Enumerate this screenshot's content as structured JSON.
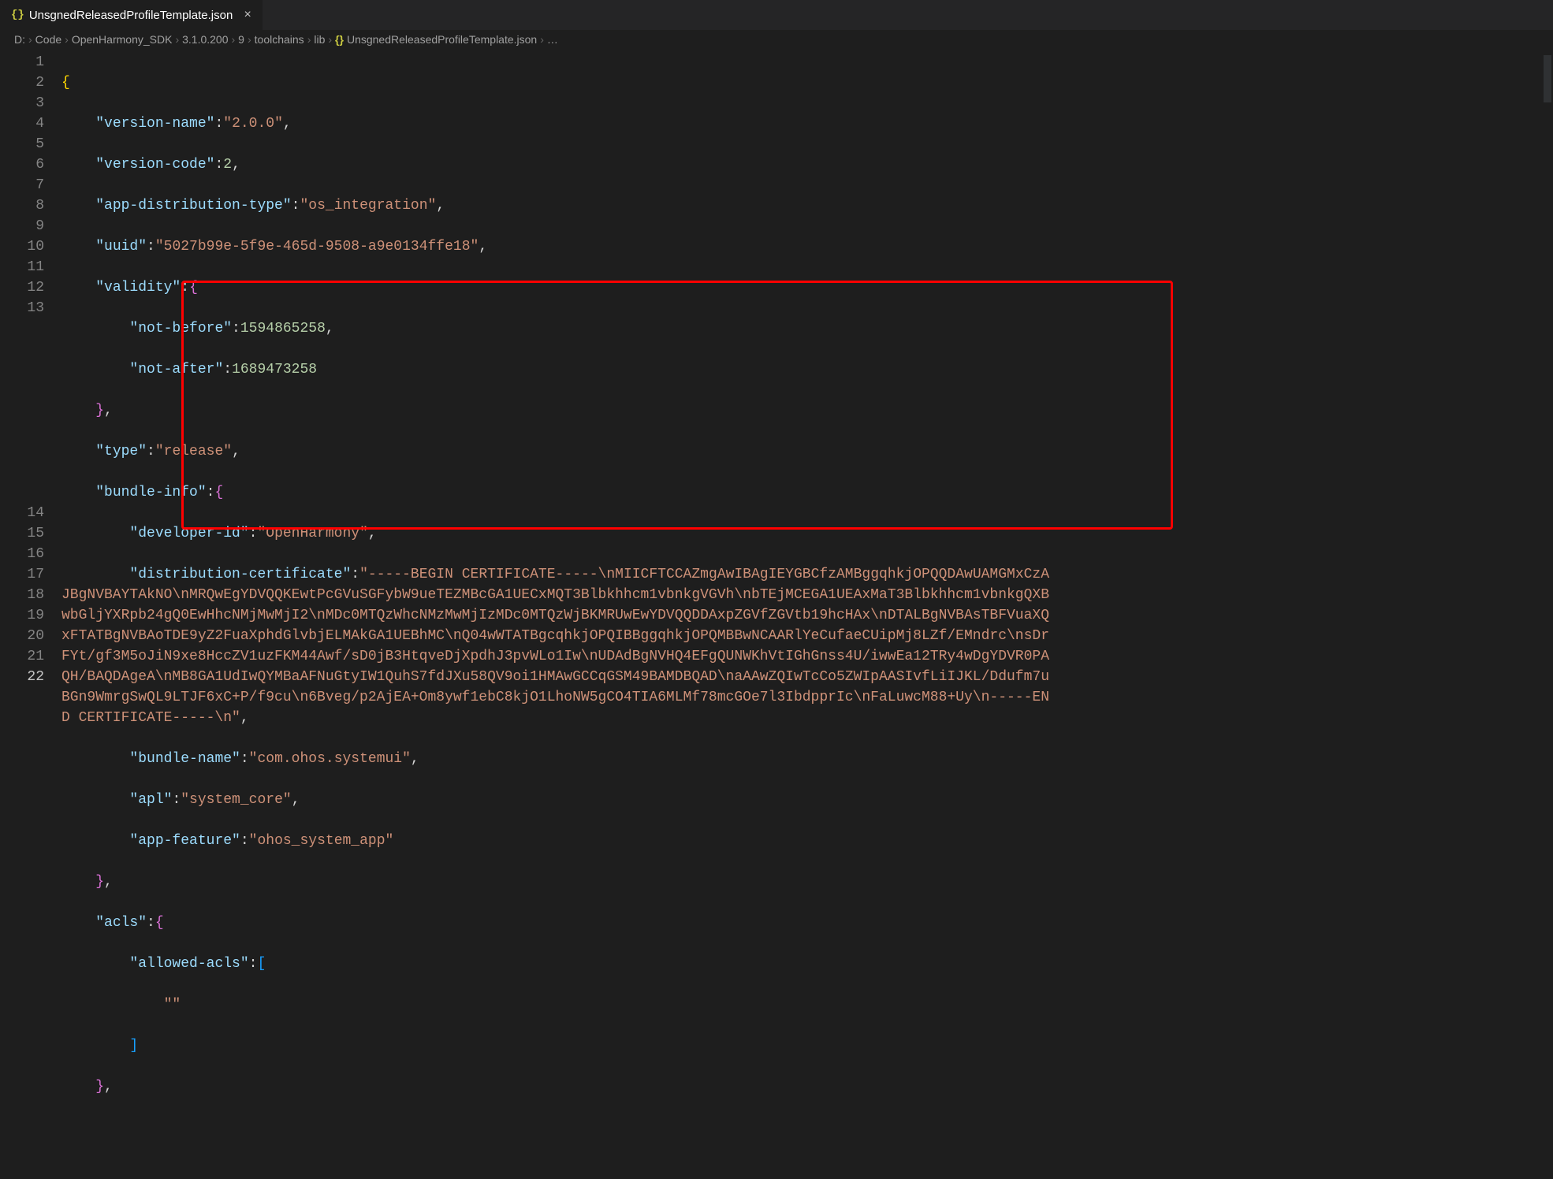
{
  "tab": {
    "icon": "{}",
    "label": "UnsgnedReleasedProfileTemplate.json",
    "close": "×"
  },
  "breadcrumb": {
    "parts": [
      "D:",
      "Code",
      "OpenHarmony_SDK",
      "3.1.0.200",
      "9",
      "toolchains",
      "lib"
    ],
    "file_icon": "{}",
    "file": "UnsgnedReleasedProfileTemplate.json",
    "trail": "…"
  },
  "gutter_lines": [
    "1",
    "2",
    "3",
    "4",
    "5",
    "6",
    "7",
    "8",
    "9",
    "10",
    "11",
    "12",
    "13",
    "14",
    "15",
    "16",
    "17",
    "18",
    "19",
    "20",
    "21",
    "22"
  ],
  "code": {
    "l1_brace": "{",
    "l2_key": "\"version-name\"",
    "l2_val": "\"2.0.0\"",
    "l3_key": "\"version-code\"",
    "l3_val": "2",
    "l4_key": "\"app-distribution-type\"",
    "l4_val": "\"os_integration\"",
    "l5_key": "\"uuid\"",
    "l5_val": "\"5027b99e-5f9e-465d-9508-a9e0134ffe18\"",
    "l6_key": "\"validity\"",
    "l7_key": "\"not-before\"",
    "l7_val": "1594865258",
    "l8_key": "\"not-after\"",
    "l8_val": "1689473258",
    "l10_key": "\"type\"",
    "l10_val": "\"release\"",
    "l11_key": "\"bundle-info\"",
    "l12_key": "\"developer-id\"",
    "l12_val": "\"OpenHarmony\"",
    "l13_key": "\"distribution-certificate\"",
    "l13_val": "\"-----BEGIN CERTIFICATE-----\\nMIICFTCCAZmgAwIBAgIEYGBCfzAMBggqhkjOPQQDAwUAMGMxCzAJBgNVBAYTAkNO\\nMRQwEgYDVQQKEwtPcGVuSGFybW9ueTEZMBcGA1UECxMQT3Blbkhhcm1vbnkgVGVh\\nbTEjMCEGA1UEAxMaT3Blbkhhcm1vbnkgQXBwbGljYXRpb24gQ0EwHhcNMjMwMjI2\\nMDc0MTQzWhcNMzMwMjIzMDc0MTQzWjBKMRUwEwYDVQQDDAxpZGVfZGVtb19hcHAx\\nDTALBgNVBAsTBFVuaXQxFTATBgNVBAoTDE9yZ2FuaXphdGlvbjELMAkGA1UEBhMC\\nQ04wWTATBgcqhkjOPQIBBggqhkjOPQMBBwNCAARlYeCufaeCUipMj8LZf/EMndrc\\nsDrFYt/gf3M5oJiN9xe8HccZV1uzFKM44Awf/sD0jB3HtqveDjXpdhJ3pvWLo1Iw\\nUDAdBgNVHQ4EFgQUNWKhVtIGhGnss4U/iwwEa12TRy4wDgYDVR0PAQH/BAQDAgeA\\nMB8GA1UdIwQYMBaAFNuGtyIW1QuhS7fdJXu58QV9oi1HMAwGCCqGSM49BAMDBQAD\\naAAwZQIwTcCo5ZWIpAASIvfLiIJKL/Ddufm7uBGn9WmrgSwQL9LTJF6xC+P/f9cu\\n6Bveg/p2AjEA+Om8ywf1ebC8kjO1LhoNW5gCO4TIA6MLMf78mcGOe7l3IbdpprIc\\nFaLuwcM88+Uy\\n-----END CERTIFICATE-----\\n\"",
    "l14_key": "\"bundle-name\"",
    "l14_val": "\"com.ohos.systemui\"",
    "l15_key": "\"apl\"",
    "l15_val": "\"system_core\"",
    "l16_key": "\"app-feature\"",
    "l16_val": "\"ohos_system_app\"",
    "l18_key": "\"acls\"",
    "l19_key": "\"allowed-acls\"",
    "l20_val": "\"\"",
    "colon": ":",
    "comma": ",",
    "obrace": "{",
    "cbrace": "}",
    "obrack": "[",
    "cbrack": "]"
  }
}
